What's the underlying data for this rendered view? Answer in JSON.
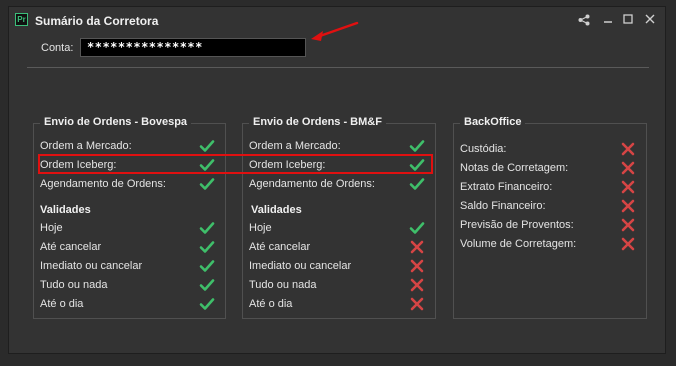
{
  "window": {
    "title": "Sumário da Corretora",
    "app_icon_text": "Pr"
  },
  "conta": {
    "label": "Conta:",
    "value": "***************"
  },
  "colors": {
    "check": "#3fbf6a",
    "cross": "#d64545",
    "highlight": "#e01010"
  },
  "panels": {
    "bovespa": {
      "title": "Envio de Ordens - Bovespa",
      "orders": [
        {
          "label": "Ordem a Mercado:",
          "status": "check"
        },
        {
          "label": "Ordem Iceberg:",
          "status": "check"
        },
        {
          "label": "Agendamento de Ordens:",
          "status": "check"
        }
      ],
      "validades_title": "Validades",
      "validades": [
        {
          "label": "Hoje",
          "status": "check"
        },
        {
          "label": "Até cancelar",
          "status": "check"
        },
        {
          "label": "Imediato ou cancelar",
          "status": "check"
        },
        {
          "label": "Tudo ou nada",
          "status": "check"
        },
        {
          "label": "Até o dia",
          "status": "check"
        }
      ]
    },
    "bmf": {
      "title": "Envio de Ordens - BM&F",
      "orders": [
        {
          "label": "Ordem a Mercado:",
          "status": "check"
        },
        {
          "label": "Ordem Iceberg:",
          "status": "check"
        },
        {
          "label": "Agendamento de Ordens:",
          "status": "check"
        }
      ],
      "validades_title": "Validades",
      "validades": [
        {
          "label": "Hoje",
          "status": "check"
        },
        {
          "label": "Até cancelar",
          "status": "cross"
        },
        {
          "label": "Imediato ou cancelar",
          "status": "cross"
        },
        {
          "label": "Tudo ou nada",
          "status": "cross"
        },
        {
          "label": "Até o dia",
          "status": "cross"
        }
      ]
    },
    "backoffice": {
      "title": "BackOffice",
      "items": [
        {
          "label": "Custódia:",
          "status": "cross"
        },
        {
          "label": "Notas de Corretagem:",
          "status": "cross"
        },
        {
          "label": "Extrato Financeiro:",
          "status": "cross"
        },
        {
          "label": "Saldo Financeiro:",
          "status": "cross"
        },
        {
          "label": "Previsão de Proventos:",
          "status": "cross"
        },
        {
          "label": "Volume de Corretagem:",
          "status": "cross"
        }
      ]
    }
  }
}
